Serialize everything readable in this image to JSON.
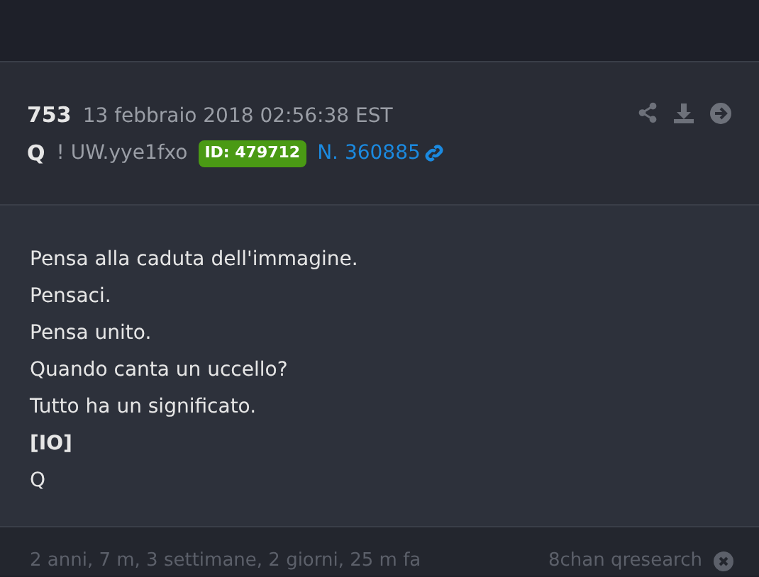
{
  "post": {
    "number": "753",
    "date": "13 febbraio 2018 02:56:38 EST",
    "author": "Q",
    "tripcode": "! UW.yye1fxo",
    "id_badge": "ID: 479712",
    "post_link": "N. 360885"
  },
  "body": [
    "Pensa alla caduta dell'immagine.",
    "Pensaci.",
    "Pensa unito.",
    "Quando canta un uccello?",
    "Tutto ha un significato.",
    "[IO]",
    "Q"
  ],
  "footer": {
    "age": "2 anni, 7 m, 3 settimane, 2 giorni, 25 m fa",
    "source": "8chan qresearch"
  }
}
